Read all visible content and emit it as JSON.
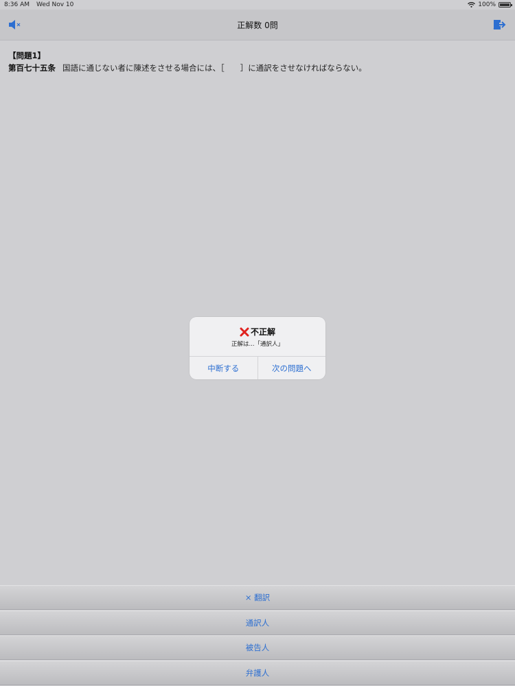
{
  "status": {
    "time": "8:36 AM",
    "date": "Wed Nov 10",
    "battery": "100%"
  },
  "nav": {
    "title": "正解数 0問",
    "left_icon": "mute-speaker-icon",
    "right_icon": "exit-icon"
  },
  "question": {
    "label": "【問題1】",
    "article": "第百七十五条",
    "text": "国語に通じない者に陳述をさせる場合には、［　　］に通訳をさせなければならない。"
  },
  "alert": {
    "title": "不正解",
    "title_icon": "red-cross-icon",
    "message": "正解は...「通訳人」",
    "buttons": [
      "中断する",
      "次の問題へ"
    ]
  },
  "answers": [
    "× 翻訳",
    "通訳人",
    "被告人",
    "弁護人"
  ],
  "colors": {
    "accent": "#2d6fd1",
    "error": "#e0221f"
  }
}
